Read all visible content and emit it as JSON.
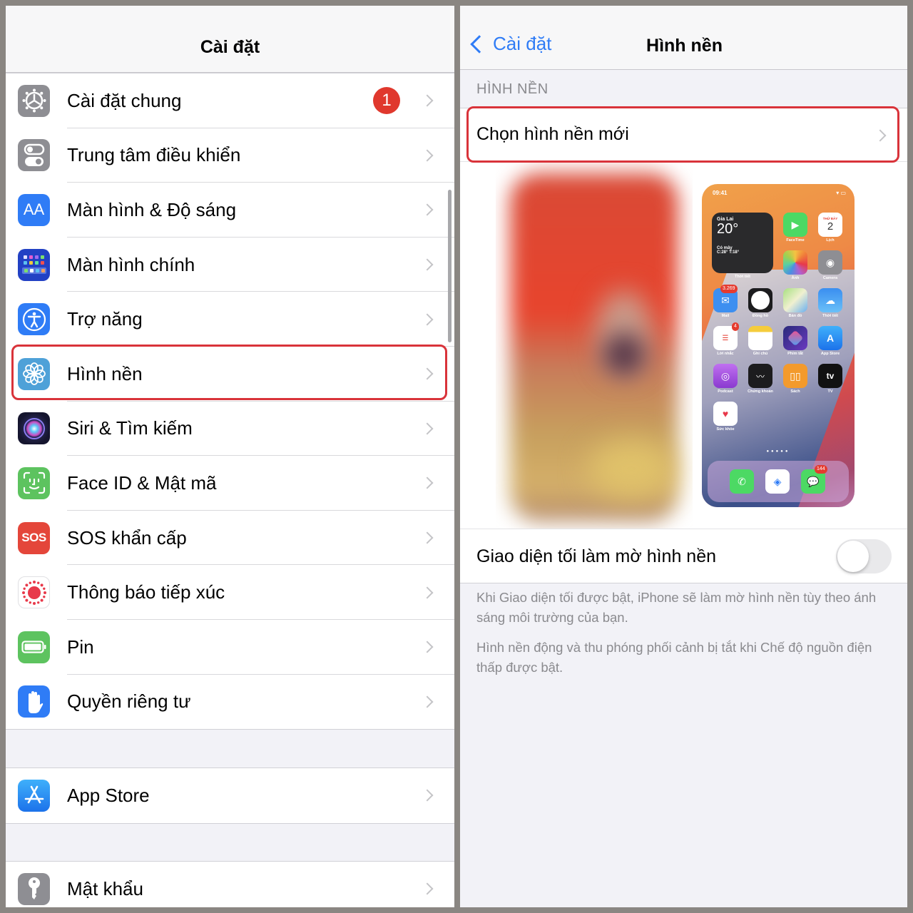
{
  "left": {
    "title": "Cài đặt",
    "groups": [
      {
        "items": [
          {
            "label": "Cài đặt chung",
            "icon": "gear-icon",
            "color": "#8e8e93",
            "badge": "1"
          },
          {
            "label": "Trung tâm điều khiển",
            "icon": "toggles-icon",
            "color": "#8e8e93"
          },
          {
            "label": "Màn hình & Độ sáng",
            "icon": "text-size-icon",
            "color": "#2f7cf6",
            "glyph": "AA"
          },
          {
            "label": "Màn hình chính",
            "icon": "home-screen-grid-icon",
            "color": "#2241c4"
          },
          {
            "label": "Trợ năng",
            "icon": "accessibility-icon",
            "color": "#2f7cf6"
          },
          {
            "label": "Hình nền",
            "icon": "flower-icon",
            "color": "#4ea1d8",
            "highlighted": true
          },
          {
            "label": "Siri & Tìm kiếm",
            "icon": "siri-icon",
            "color": "#1c1c3a"
          },
          {
            "label": "Face ID & Mật mã",
            "icon": "face-id-icon",
            "color": "#5dc35f"
          },
          {
            "label": "SOS khẩn cấp",
            "icon": "sos-icon",
            "color": "#e4463a",
            "glyph": "SOS"
          },
          {
            "label": "Thông báo tiếp xúc",
            "icon": "exposure-notification-icon",
            "color": "#ffffff"
          },
          {
            "label": "Pin",
            "icon": "battery-icon",
            "color": "#5dc35f"
          },
          {
            "label": "Quyền riêng tư",
            "icon": "hand-icon",
            "color": "#2f7cf6"
          }
        ]
      },
      {
        "items": [
          {
            "label": "App Store",
            "icon": "app-store-icon",
            "color": "#2f8df6"
          }
        ]
      },
      {
        "items": [
          {
            "label": "Mật khẩu",
            "icon": "key-icon",
            "color": "#8e8e93"
          }
        ]
      }
    ]
  },
  "right": {
    "back_label": "Cài đặt",
    "title": "Hình nền",
    "section_header": "HÌNH NỀN",
    "choose_label": "Chọn hình nền mới",
    "home_preview": {
      "time": "09:41",
      "weather": {
        "city": "Gia Lai",
        "temp": "20°",
        "condition": "Có mây",
        "range": "C:28° T:18°",
        "label": "Thời tiết"
      },
      "calendar": {
        "day": "THỨ BẢY",
        "date": "2"
      },
      "apps": [
        {
          "label": "FaceTime"
        },
        {
          "label": "Lịch"
        },
        {
          "label": "Ảnh"
        },
        {
          "label": "Camera"
        },
        {
          "label": "Mail",
          "badge": "3.269"
        },
        {
          "label": "Đồng hồ"
        },
        {
          "label": "Bản đồ"
        },
        {
          "label": "Thời tiết"
        },
        {
          "label": "Lời nhắc",
          "badge": "4"
        },
        {
          "label": "Ghi chú"
        },
        {
          "label": "Phím tắt"
        },
        {
          "label": "App Store"
        },
        {
          "label": "Podcast"
        },
        {
          "label": "Chứng khoán"
        },
        {
          "label": "Sách"
        },
        {
          "label": "TV",
          "glyph": "tv"
        },
        {
          "label": "Sức khỏe"
        }
      ],
      "dock_badge": "144"
    },
    "dark_dim_label": "Giao diện tối làm mờ hình nền",
    "dark_dim_on": false,
    "footnote_1": "Khi Giao diện tối được bật, iPhone sẽ làm mờ hình nền tùy theo ánh sáng môi trường của bạn.",
    "footnote_2": "Hình nền động và thu phóng phối cảnh bị tắt khi Chế độ nguồn điện thấp được bật.",
    "highlight_color": "#d9333a",
    "accent_color": "#2f7cf6"
  }
}
